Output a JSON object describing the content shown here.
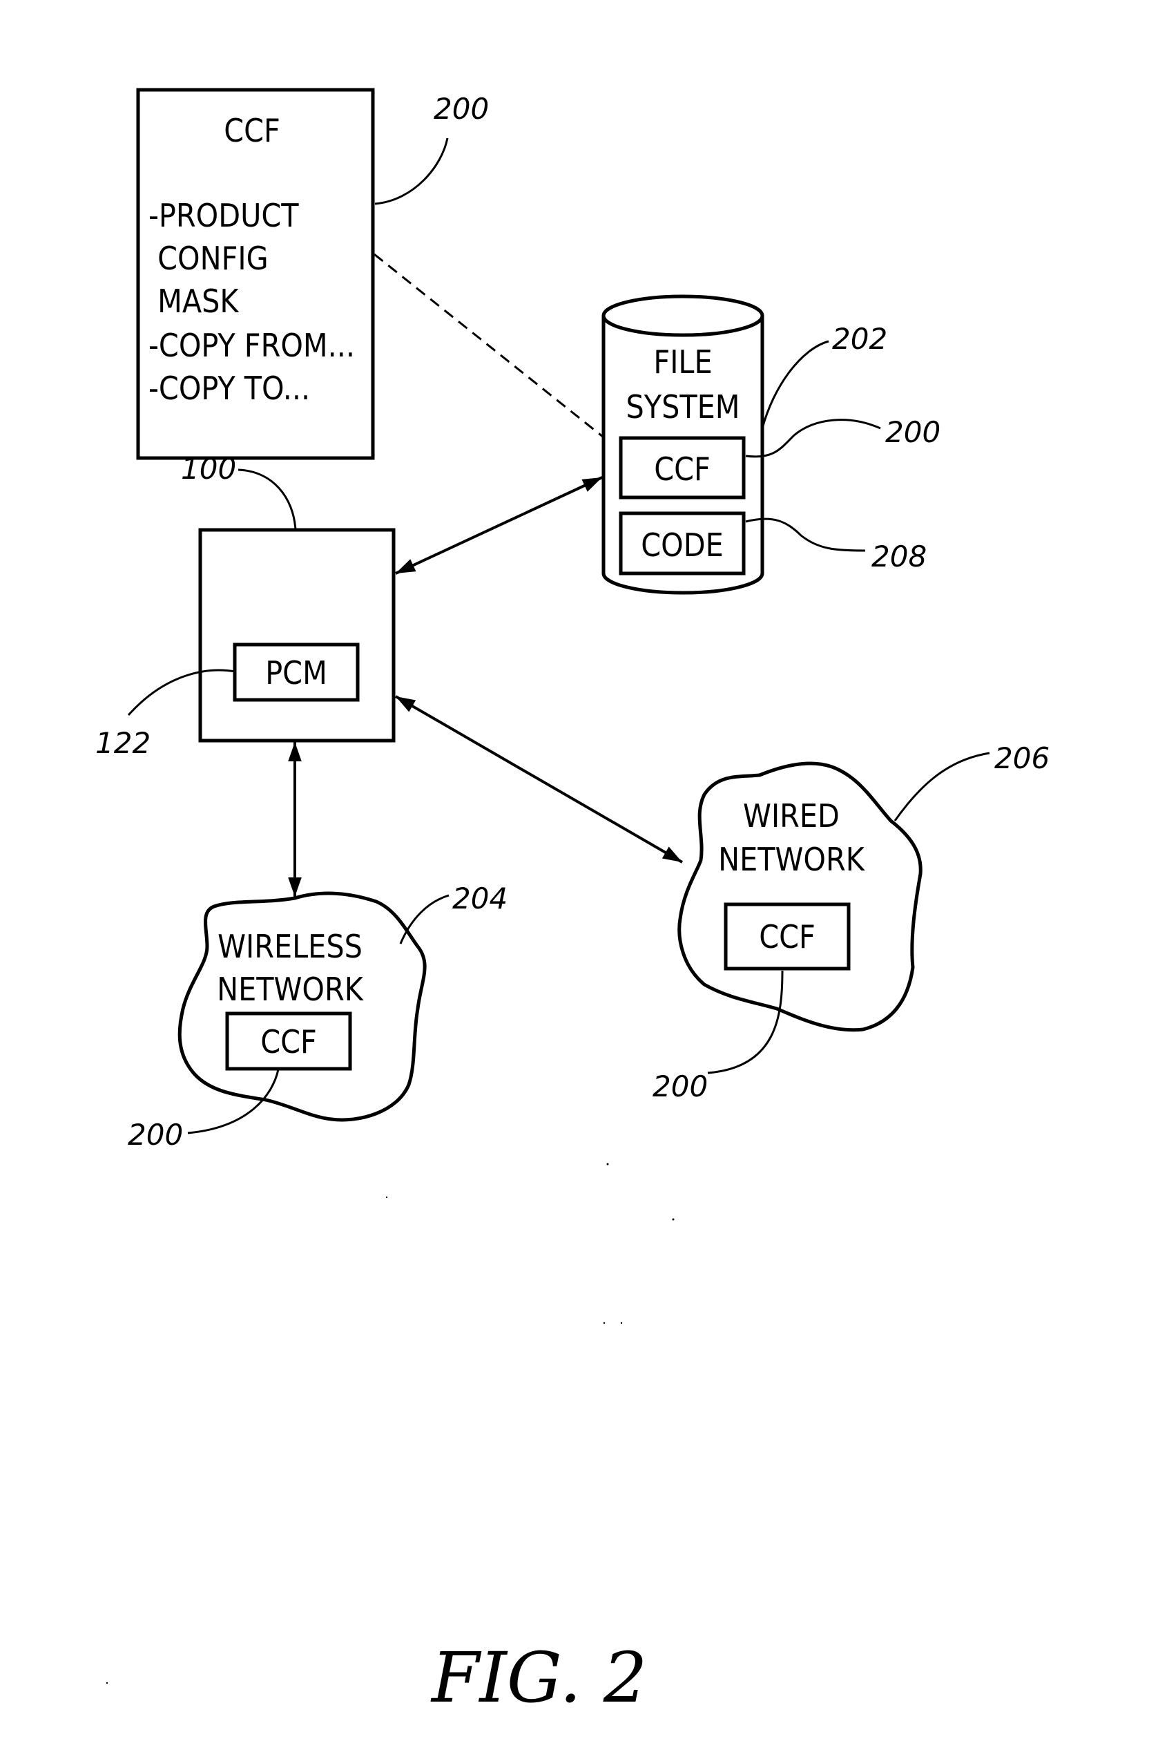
{
  "figure": {
    "caption": "FIG. 2"
  },
  "ccf_detail": {
    "title": "CCF",
    "lines": [
      "-PRODUCT",
      " CONFIG",
      " MASK",
      "-COPY FROM...",
      "-COPY TO..."
    ],
    "ref": "200"
  },
  "file_system": {
    "title_line1": "FILE",
    "title_line2": "SYSTEM",
    "ref": "202",
    "ccf_label": "CCF",
    "ccf_ref": "200",
    "code_label": "CODE",
    "code_ref": "208"
  },
  "device": {
    "ref": "100",
    "pcm_label": "PCM",
    "pcm_ref": "122"
  },
  "wireless_network": {
    "line1": "WIRELESS",
    "line2": "NETWORK",
    "ref": "204",
    "ccf_label": "CCF",
    "ccf_ref": "200"
  },
  "wired_network": {
    "line1": "WIRED",
    "line2": "NETWORK",
    "ref": "206",
    "ccf_label": "CCF",
    "ccf_ref": "200"
  },
  "connections": [
    {
      "from": "device",
      "to": "file_system",
      "type": "bidirectional-arrow"
    },
    {
      "from": "device",
      "to": "wired_network",
      "type": "bidirectional-arrow"
    },
    {
      "from": "device",
      "to": "wireless_network",
      "type": "bidirectional-arrow"
    },
    {
      "from": "ccf_detail",
      "to": "file_system.ccf",
      "type": "dashed-line"
    }
  ]
}
